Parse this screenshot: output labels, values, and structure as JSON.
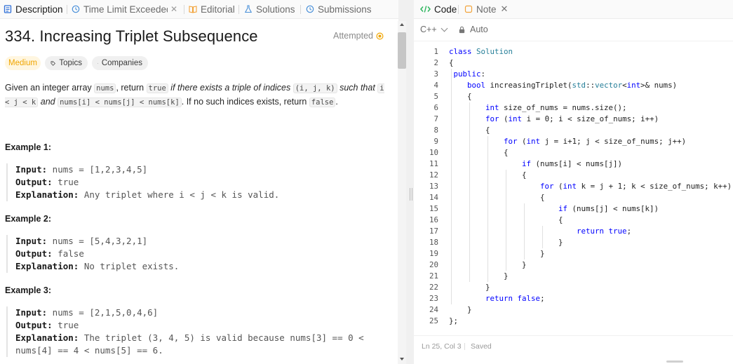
{
  "tabs": [
    {
      "label": "Description"
    },
    {
      "label": "Time Limit Exceeded"
    },
    {
      "label": "Editorial"
    },
    {
      "label": "Solutions"
    },
    {
      "label": "Submissions"
    }
  ],
  "problem": {
    "title": "334. Increasing Triplet Subsequence",
    "status": "Attempted",
    "difficulty": "Medium",
    "topics_label": "Topics",
    "companies_label": "Companies"
  },
  "description": {
    "t1": "Given an integer array ",
    "c1": "nums",
    "t2": ", return ",
    "c2": "true",
    "t3": " if there exists a triple of indices ",
    "c3": "(i, j, k)",
    "t4": " such that ",
    "c4": "i < j < k",
    "t5": " and ",
    "c5": "nums[i] < nums[j] < nums[k]",
    "t6": ". If no such indices exists, return ",
    "c6": "false",
    "t7": "."
  },
  "examples": [
    {
      "heading": "Example 1:",
      "input_label": "Input:",
      "input": " nums = [1,2,3,4,5]",
      "output_label": "Output:",
      "output": " true",
      "expl_label": "Explanation:",
      "expl": " Any triplet where i < j < k is valid."
    },
    {
      "heading": "Example 2:",
      "input_label": "Input:",
      "input": " nums = [5,4,3,2,1]",
      "output_label": "Output:",
      "output": " false",
      "expl_label": "Explanation:",
      "expl": " No triplet exists."
    },
    {
      "heading": "Example 3:",
      "input_label": "Input:",
      "input": " nums = [2,1,5,0,4,6]",
      "output_label": "Output:",
      "output": " true",
      "expl_label": "Explanation:",
      "expl": " The triplet (3, 4, 5) is valid because nums[3] == 0 < nums[4] == 4 < nums[5] == 6."
    }
  ],
  "editor_tabs": [
    {
      "label": "Code"
    },
    {
      "label": "Note"
    }
  ],
  "toolbar": {
    "language": "C++",
    "mode": "Auto"
  },
  "code": [
    {
      "n": "1",
      "text": "class Solution"
    },
    {
      "n": "2",
      "text": "{"
    },
    {
      "n": "3",
      "text": " public:"
    },
    {
      "n": "4",
      "text": "    bool increasingTriplet(std::vector<int>& nums)"
    },
    {
      "n": "5",
      "text": "    {"
    },
    {
      "n": "6",
      "text": "        int size_of_nums = nums.size();"
    },
    {
      "n": "7",
      "text": "        for (int i = 0; i < size_of_nums; i++)"
    },
    {
      "n": "8",
      "text": "        {"
    },
    {
      "n": "9",
      "text": "            for (int j = i+1; j < size_of_nums; j++)"
    },
    {
      "n": "10",
      "text": "            {"
    },
    {
      "n": "11",
      "text": "                if (nums[i] < nums[j])"
    },
    {
      "n": "12",
      "text": "                {"
    },
    {
      "n": "13",
      "text": "                    for (int k = j + 1; k < size_of_nums; k++)"
    },
    {
      "n": "14",
      "text": "                    {"
    },
    {
      "n": "15",
      "text": "                        if (nums[j] < nums[k])"
    },
    {
      "n": "16",
      "text": "                        {"
    },
    {
      "n": "17",
      "text": "                            return true;"
    },
    {
      "n": "18",
      "text": "                        }"
    },
    {
      "n": "19",
      "text": "                    }"
    },
    {
      "n": "20",
      "text": "                }"
    },
    {
      "n": "21",
      "text": "            }"
    },
    {
      "n": "22",
      "text": "        }"
    },
    {
      "n": "23",
      "text": "        return false;"
    },
    {
      "n": "24",
      "text": "    }"
    },
    {
      "n": "25",
      "text": "};"
    }
  ],
  "status": {
    "cursor": "Ln 25, Col 3",
    "save_state": "Saved"
  },
  "colors": {
    "accent_green": "#2db55d",
    "medium": "#f0a500",
    "keyword": "#0000ff",
    "type": "#267f99"
  },
  "icons": [
    "description-icon",
    "history-icon",
    "book-icon",
    "flask-icon",
    "code-icon",
    "note-icon",
    "close-icon",
    "tag-icon",
    "lock-icon",
    "attempted-icon",
    "chevron-down-icon"
  ]
}
